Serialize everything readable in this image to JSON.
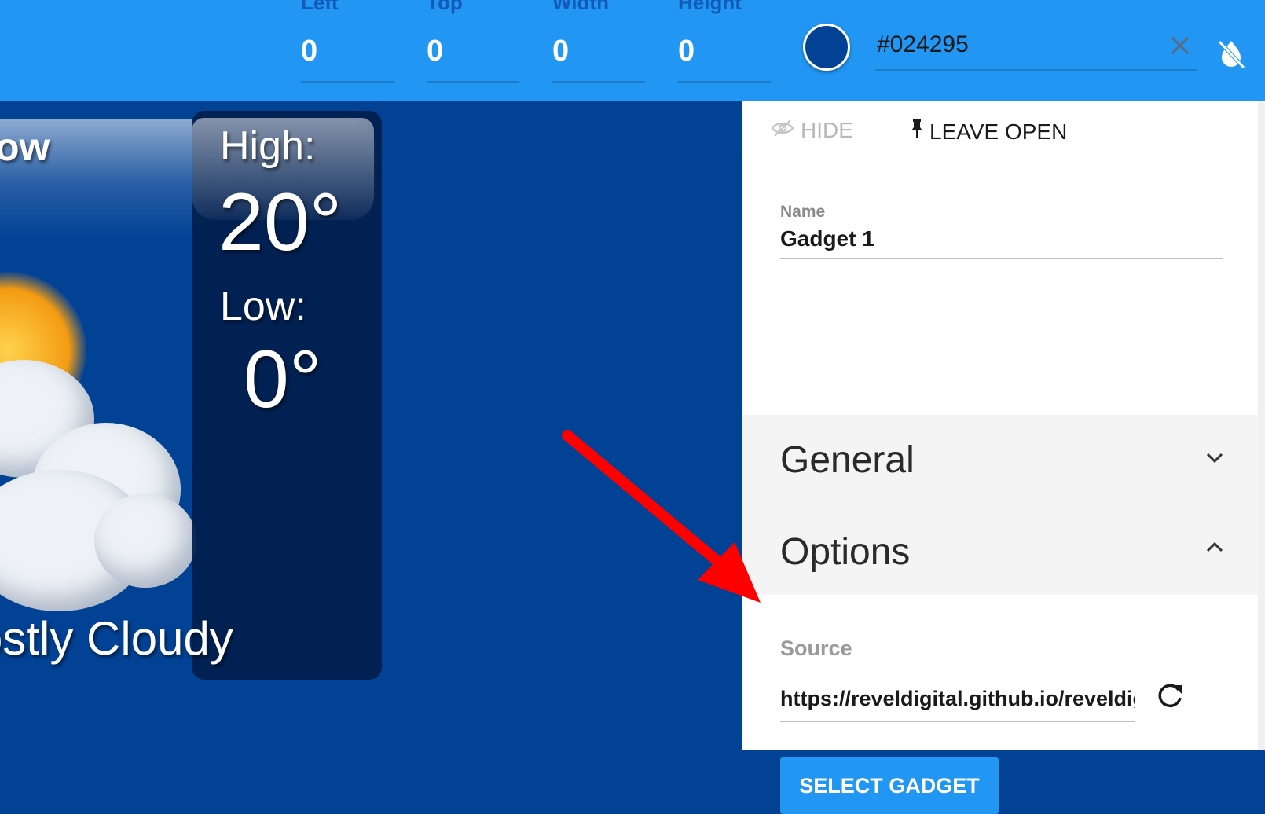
{
  "toolbar": {
    "fields": [
      {
        "label": "Left",
        "value": "0"
      },
      {
        "label": "Top",
        "value": "0"
      },
      {
        "label": "Width",
        "value": "0"
      },
      {
        "label": "Height",
        "value": "0"
      }
    ],
    "color_value": "#024295",
    "swatch_color": "#024295",
    "clear_icon": "close-icon",
    "no_fill_icon": "invert-colors-off-icon",
    "accent": "#2196f3"
  },
  "preview": {
    "day_fragment": "ow",
    "high_label": "High:",
    "high_value": "20°",
    "low_label": "Low:",
    "low_value": "0°",
    "condition": "ostly Cloudy",
    "icon": "partly-cloudy-sun-icon"
  },
  "panel": {
    "tabs": {
      "hide_label": "HIDE",
      "hide_icon": "eye-off-icon",
      "leave_open_label": "LEAVE OPEN",
      "leave_open_icon": "pin-icon"
    },
    "name": {
      "label": "Name",
      "value": "Gadget 1"
    },
    "sections": {
      "general": {
        "title": "General",
        "icon": "chevron-down-icon"
      },
      "options": {
        "title": "Options",
        "icon": "chevron-up-icon"
      }
    },
    "source": {
      "label": "Source",
      "value": "https://reveldigital.github.io/reveldigital-gadgets",
      "refresh_icon": "refresh-icon"
    },
    "select_button": "SELECT GADGET"
  },
  "annotation": {
    "arrow_color": "#ff0000"
  }
}
